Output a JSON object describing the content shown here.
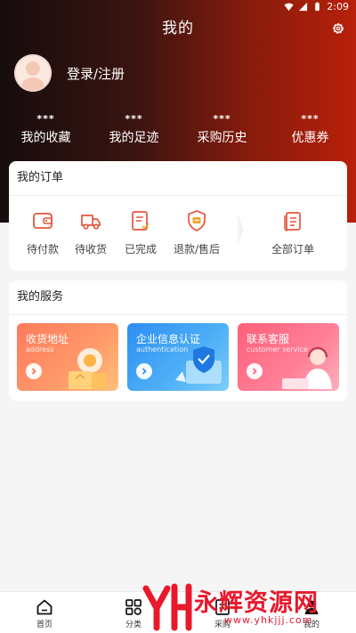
{
  "status_bar": {
    "time": "2:09"
  },
  "header": {
    "title": "我的"
  },
  "profile": {
    "login_label": "登录/注册"
  },
  "stats": [
    {
      "value": "***",
      "label": "我的收藏"
    },
    {
      "value": "***",
      "label": "我的足迹"
    },
    {
      "value": "***",
      "label": "采购历史"
    },
    {
      "value": "***",
      "label": "优惠券"
    }
  ],
  "orders": {
    "title": "我的订单",
    "items": [
      {
        "label": "待付款",
        "icon": "wallet-icon"
      },
      {
        "label": "待收货",
        "icon": "truck-icon"
      },
      {
        "label": "已完成",
        "icon": "checklist-icon"
      },
      {
        "label": "退款/售后",
        "icon": "after-sales-shield-icon"
      }
    ],
    "all_label": "全部订单"
  },
  "services": {
    "title": "我的服务",
    "items": [
      {
        "title": "收货地址",
        "subtitle": "address"
      },
      {
        "title": "企业信息认证",
        "subtitle": "authentication"
      },
      {
        "title": "联系客服",
        "subtitle": "customer service"
      }
    ]
  },
  "tabbar": {
    "items": [
      {
        "label": "首页"
      },
      {
        "label": "分类"
      },
      {
        "label": "采购"
      },
      {
        "label": "我的"
      }
    ]
  },
  "watermark": {
    "title": "永辉资源网",
    "url": "www.yhkjjj.com"
  },
  "colors": {
    "accent": "#e2553a",
    "hero_dark": "#160d0d",
    "hero_red": "#b8200a",
    "watermark_red": "#e8192c"
  }
}
